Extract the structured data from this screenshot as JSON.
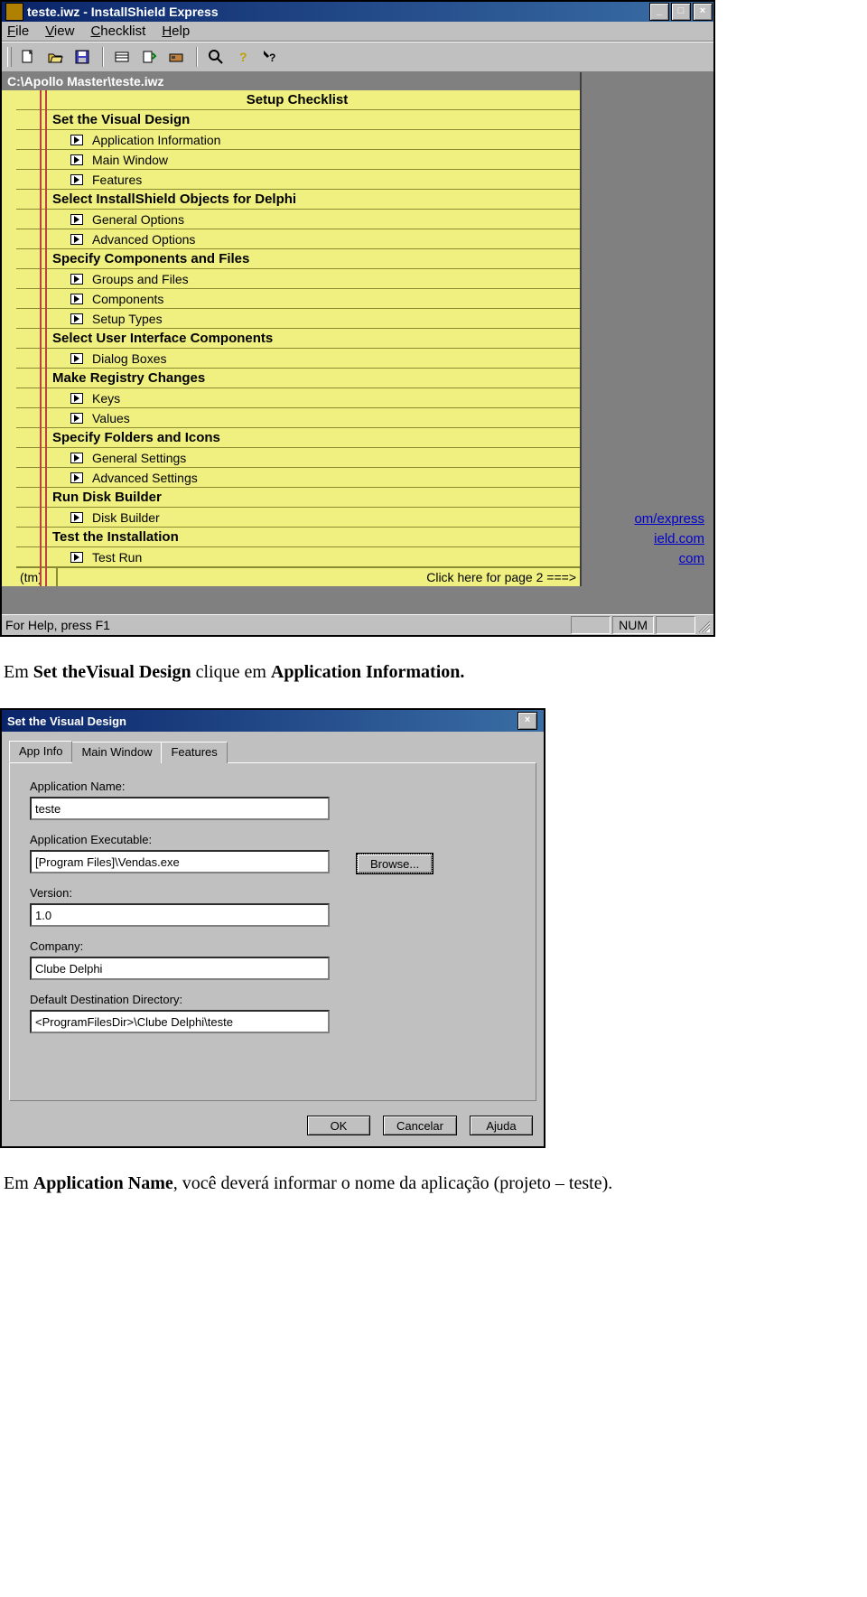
{
  "mainWindow": {
    "title": "teste.iwz - InstallShield Express",
    "menu": {
      "file": "File",
      "view": "View",
      "checklist": "Checklist",
      "help": "Help"
    },
    "childTitle": "C:\\Apollo Master\\teste.iwz",
    "checklist": {
      "heading": "Setup Checklist",
      "sections": [
        {
          "title": "Set the Visual Design",
          "items": [
            "Application Information",
            "Main Window",
            "Features"
          ]
        },
        {
          "title": "Select InstallShield Objects for Delphi",
          "items": [
            "General Options",
            "Advanced Options"
          ]
        },
        {
          "title": "Specify Components and Files",
          "items": [
            "Groups and Files",
            "Components",
            "Setup Types"
          ]
        },
        {
          "title": "Select User Interface Components",
          "items": [
            "Dialog Boxes"
          ]
        },
        {
          "title": "Make Registry Changes",
          "items": [
            "Keys",
            "Values"
          ]
        },
        {
          "title": "Specify Folders and Icons",
          "items": [
            "General Settings",
            "Advanced Settings"
          ]
        },
        {
          "title": "Run Disk Builder",
          "items": [
            "Disk Builder"
          ]
        },
        {
          "title": "Test the Installation",
          "items": [
            "Test Run"
          ]
        }
      ],
      "footer": {
        "tm": "(tm)",
        "pager": "Click here for page 2 ===>"
      }
    },
    "bgLinks": {
      "l1": "om/express",
      "l2": "ield.com",
      "l3": "com"
    },
    "status": {
      "hint": "For Help, press F1",
      "num": "NUM"
    }
  },
  "caption1_a": "Em ",
  "caption1_b": "Set theVisual Design",
  "caption1_c": " clique em ",
  "caption1_d": "Application Information.",
  "dialog": {
    "title": "Set the Visual Design",
    "tabs": {
      "appinfo": "App Info",
      "mainwin": "Main Window",
      "features": "Features"
    },
    "labels": {
      "appname": "Application Name:",
      "appexe": "Application Executable:",
      "version": "Version:",
      "company": "Company:",
      "destdir": "Default Destination Directory:"
    },
    "values": {
      "appname": "teste",
      "appexe": "[Program Files]\\Vendas.exe",
      "version": "1.0",
      "company": "Clube Delphi",
      "destdir": "<ProgramFilesDir>\\Clube Delphi\\teste"
    },
    "buttons": {
      "browse": "Browse...",
      "ok": "OK",
      "cancel": "Cancelar",
      "help": "Ajuda"
    }
  },
  "caption2_a": "Em ",
  "caption2_b": "Application Name",
  "caption2_c": ", você deverá informar o nome da aplicação (projeto – teste)."
}
